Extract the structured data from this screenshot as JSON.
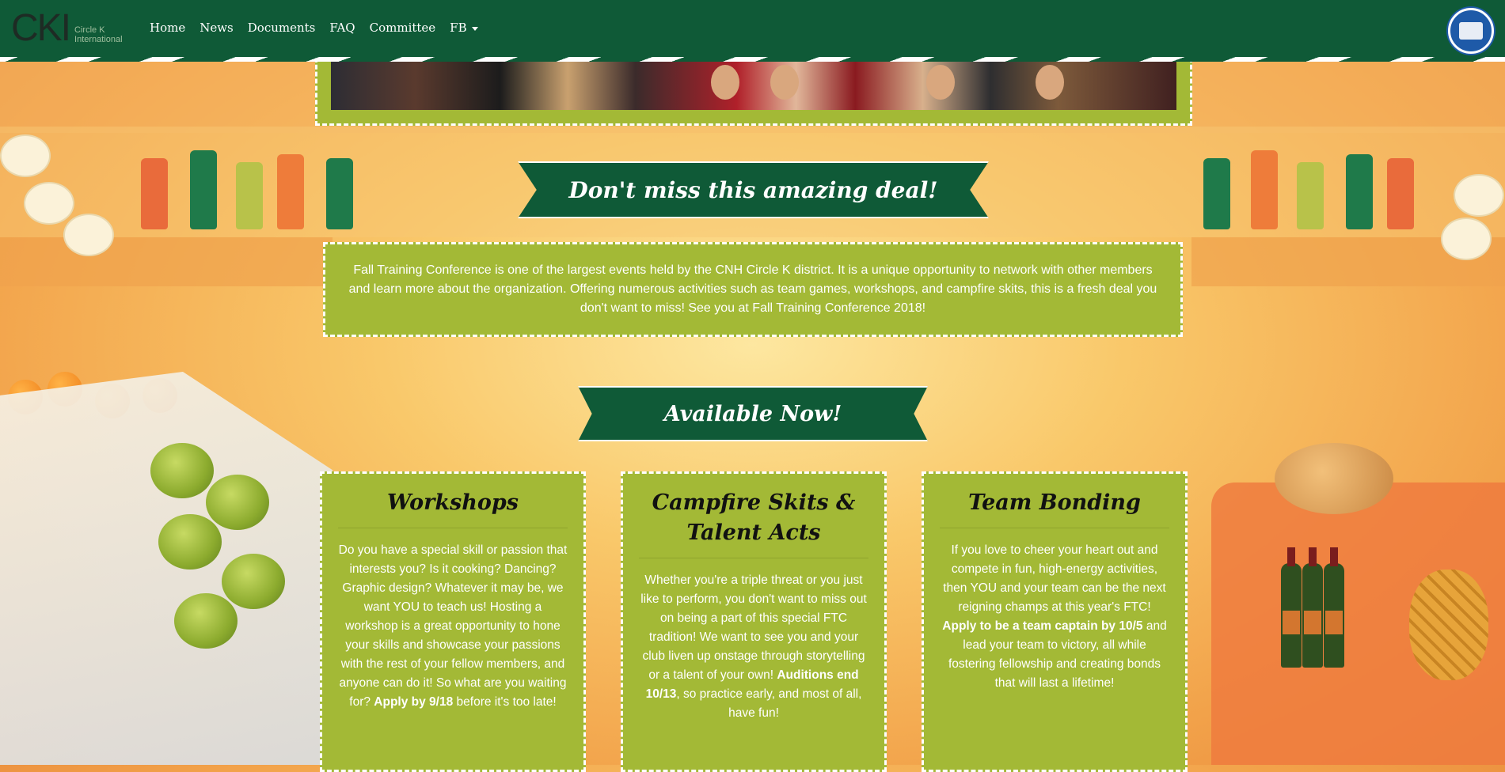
{
  "nav": {
    "brand_logo": "CKI",
    "brand_sub_1": "Circle K",
    "brand_sub_2": "International",
    "links": [
      "Home",
      "News",
      "Documents",
      "FAQ",
      "Committee",
      "FB"
    ],
    "seal_icon": "district-seal-icon"
  },
  "colors": {
    "nav_green": "#0f5a37",
    "box_green": "#a3b936",
    "accent_white": "#ffffff"
  },
  "banners": {
    "deal": "Don't miss this amazing deal!",
    "available": "Available Now!"
  },
  "description": "Fall Training Conference is one of the largest events held by the CNH Circle K district. It is a unique opportunity to network with other members and learn more about the organization. Offering numerous activities such as team games, workshops, and campfire skits, this is a fresh deal you don't want to miss! See you at Fall Training Conference 2018!",
  "cards": {
    "workshops": {
      "title": "Workshops",
      "text": "Do you have a special skill or passion that interests you? Is it cooking? Dancing? Graphic design? Whatever it may be, we want YOU to teach us! Hosting a workshop is a great opportunity to hone your skills and showcase your passions with the rest of your fellow members, and anyone can do it! So what are you waiting for?",
      "bold": "Apply by 9/18",
      "text_after": "before it's too late!"
    },
    "skits": {
      "title": "Campfire Skits & Talent Acts",
      "text": "Whether you're a triple threat or you just like to perform, you don't want to miss out on being a part of this special FTC tradition! We want to see you and your club liven up onstage through storytelling or a talent of your own!",
      "bold": "Auditions end 10/13",
      "text_after": ", so practice early, and most of all, have fun!"
    },
    "bonding": {
      "title": "Team Bonding",
      "text": "If you love to cheer your heart out and compete in fun, high-energy activities, then YOU and your team can be the next reigning champs at this year's FTC!",
      "bold": "Apply to be a team captain by 10/5",
      "text_after": "and lead your team to victory, all while fostering fellowship and creating bonds that will last a lifetime!"
    }
  }
}
